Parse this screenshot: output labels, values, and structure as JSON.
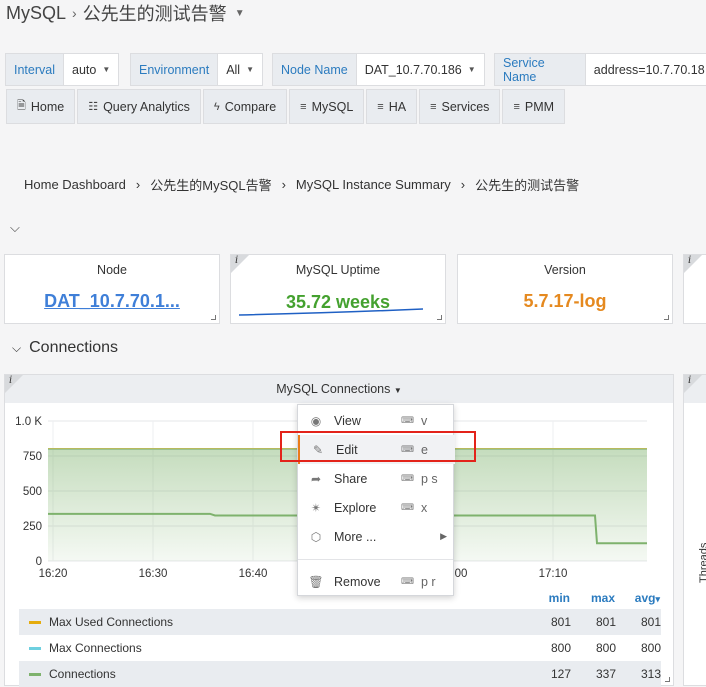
{
  "header": {
    "section": "MySQL",
    "title": "公先生的测试告警"
  },
  "variables": [
    {
      "label": "Interval",
      "value": "auto"
    },
    {
      "label": "Environment",
      "value": "All"
    },
    {
      "label": "Node Name",
      "value": "DAT_10.7.70.186"
    },
    {
      "label": "Service Name",
      "value": "address=10.7.70.18"
    }
  ],
  "nav": [
    "Home",
    "Query Analytics",
    "Compare",
    "MySQL",
    "HA",
    "Services",
    "PMM"
  ],
  "breadcrumb": [
    "Home Dashboard",
    "公先生的MySQL告警",
    "MySQL Instance Summary",
    "公先生的测试告警"
  ],
  "stats": [
    {
      "title": "Node",
      "value": "DAT_10.7.70.1...",
      "color": "#3f7fd8"
    },
    {
      "title": "MySQL Uptime",
      "value": "35.72 weeks",
      "color": "#44a12f"
    },
    {
      "title": "Version",
      "value": "5.7.17-log",
      "color": "#e5891f"
    }
  ],
  "row": {
    "title": "Connections"
  },
  "panel": {
    "title": "MySQL Connections",
    "side_label": "Threads"
  },
  "chart_data": {
    "type": "line",
    "x": [
      "16:20",
      "16:30",
      "16:40",
      "16:50",
      "17:00",
      "17:10"
    ],
    "y_ticks": [
      "0",
      "250",
      "500",
      "750",
      "1.0 K"
    ],
    "ylim": [
      0,
      1000
    ],
    "series": [
      {
        "name": "Max Used Connections",
        "color": "#e5ac0e",
        "min": "801",
        "max": "801",
        "avg": "801"
      },
      {
        "name": "Max Connections",
        "color": "#6ed0e0",
        "min": "800",
        "max": "800",
        "avg": "800"
      },
      {
        "name": "Connections",
        "color": "#7eb26d",
        "min": "127",
        "max": "337",
        "avg": "313"
      }
    ],
    "legend_headers": [
      "min",
      "max",
      "avg"
    ],
    "legend_sort_marker": "▾"
  },
  "menu": [
    {
      "icon": "eye-icon",
      "label": "View",
      "shortcut": "v"
    },
    {
      "icon": "edit-icon",
      "label": "Edit",
      "shortcut": "e"
    },
    {
      "icon": "share-icon",
      "label": "Share",
      "shortcut": "p s"
    },
    {
      "icon": "compass-icon",
      "label": "Explore",
      "shortcut": "x"
    },
    {
      "icon": "cube-icon",
      "label": "More ...",
      "shortcut": ""
    },
    {
      "icon": "trash-icon",
      "label": "Remove",
      "shortcut": "p r"
    }
  ]
}
